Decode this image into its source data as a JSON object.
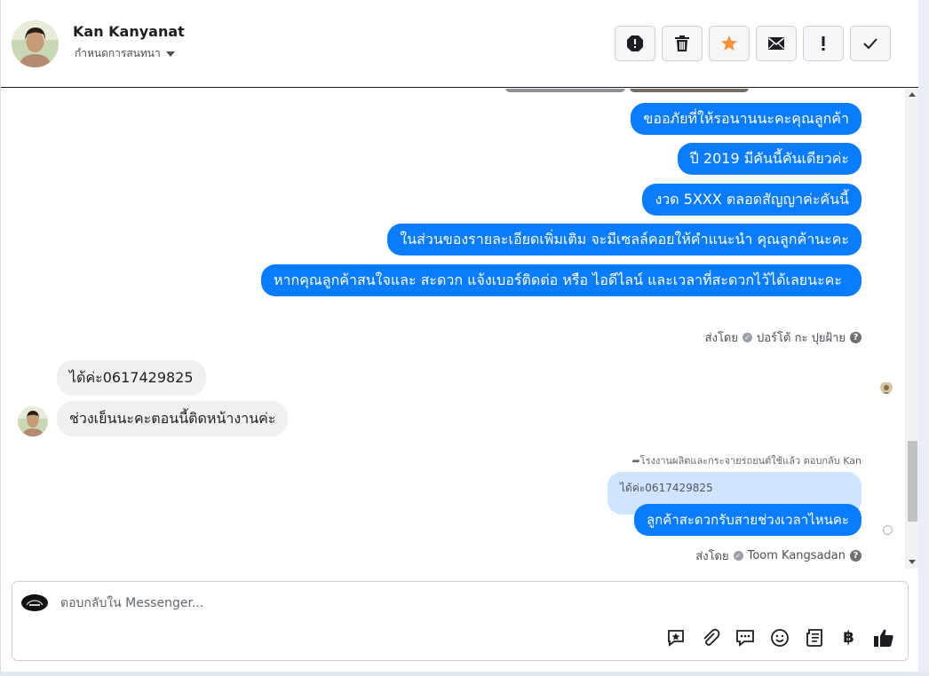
{
  "header": {
    "contact_name": "Kan Kanyanat",
    "assign_label": "กำหนดการสนทนา",
    "toolbar_icons": [
      "spam-icon",
      "trash-icon",
      "star-icon",
      "envelope-icon",
      "exclamation-icon",
      "check-icon"
    ],
    "star_color": "#f7923a"
  },
  "messages": {
    "out_1": "ขออภัยที่ให้รอนานนะคะคุณลูกค้า",
    "out_2": "ปี 2019 มีคันนี้คันเดียวค่ะ",
    "out_3": "งวด 5XXX ตลอดสัญญาค่ะคันนี้",
    "out_4": "ในส่วนของรายละเอียดเพิ่มเติม จะมีเซลล์คอยให้คำแนะนำ คุณลูกค้านะคะ",
    "out_5": "หากคุณลูกค้าสนใจและ สะดวก แจ้งเบอร์ติดต่อ หรือ ไอดีไลน์ และเวลาที่สะดวกไว้ได้เลยนะคะ",
    "sent_by_label_1": "ส่งโดย",
    "sent_by_name_1": "ปอร์โต้ กะ ปุยฝ้าย",
    "in_1": "ได้ค่ะ0617429825",
    "in_2": "ช่วงเย็นนะคะตอนนี้ติดหน้างานค่ะ",
    "reply_meta": "โรงงานผลิตและกระจายรถยนต์ใช้แล้ว ตอบกลับ Kan",
    "quoted_text": "ได้ค่ะ0617429825",
    "out_6": "ลูกค้าสะดวกรับสายช่วงเวลาไหนคะ",
    "sent_by_label_2": "ส่งโดย",
    "sent_by_name_2": "Toom Kangsadan",
    "outgoing_color": "#0a7cff",
    "incoming_color": "#f0f0f0"
  },
  "composer": {
    "placeholder": "ตอบกลับใน Messenger...",
    "tools": [
      "saved-reply-icon",
      "attachment-icon",
      "quick-reply-icon",
      "emoji-icon",
      "appointment-icon",
      "baht-payment-icon",
      "thumbs-up-icon"
    ],
    "baht_symbol": "฿"
  }
}
